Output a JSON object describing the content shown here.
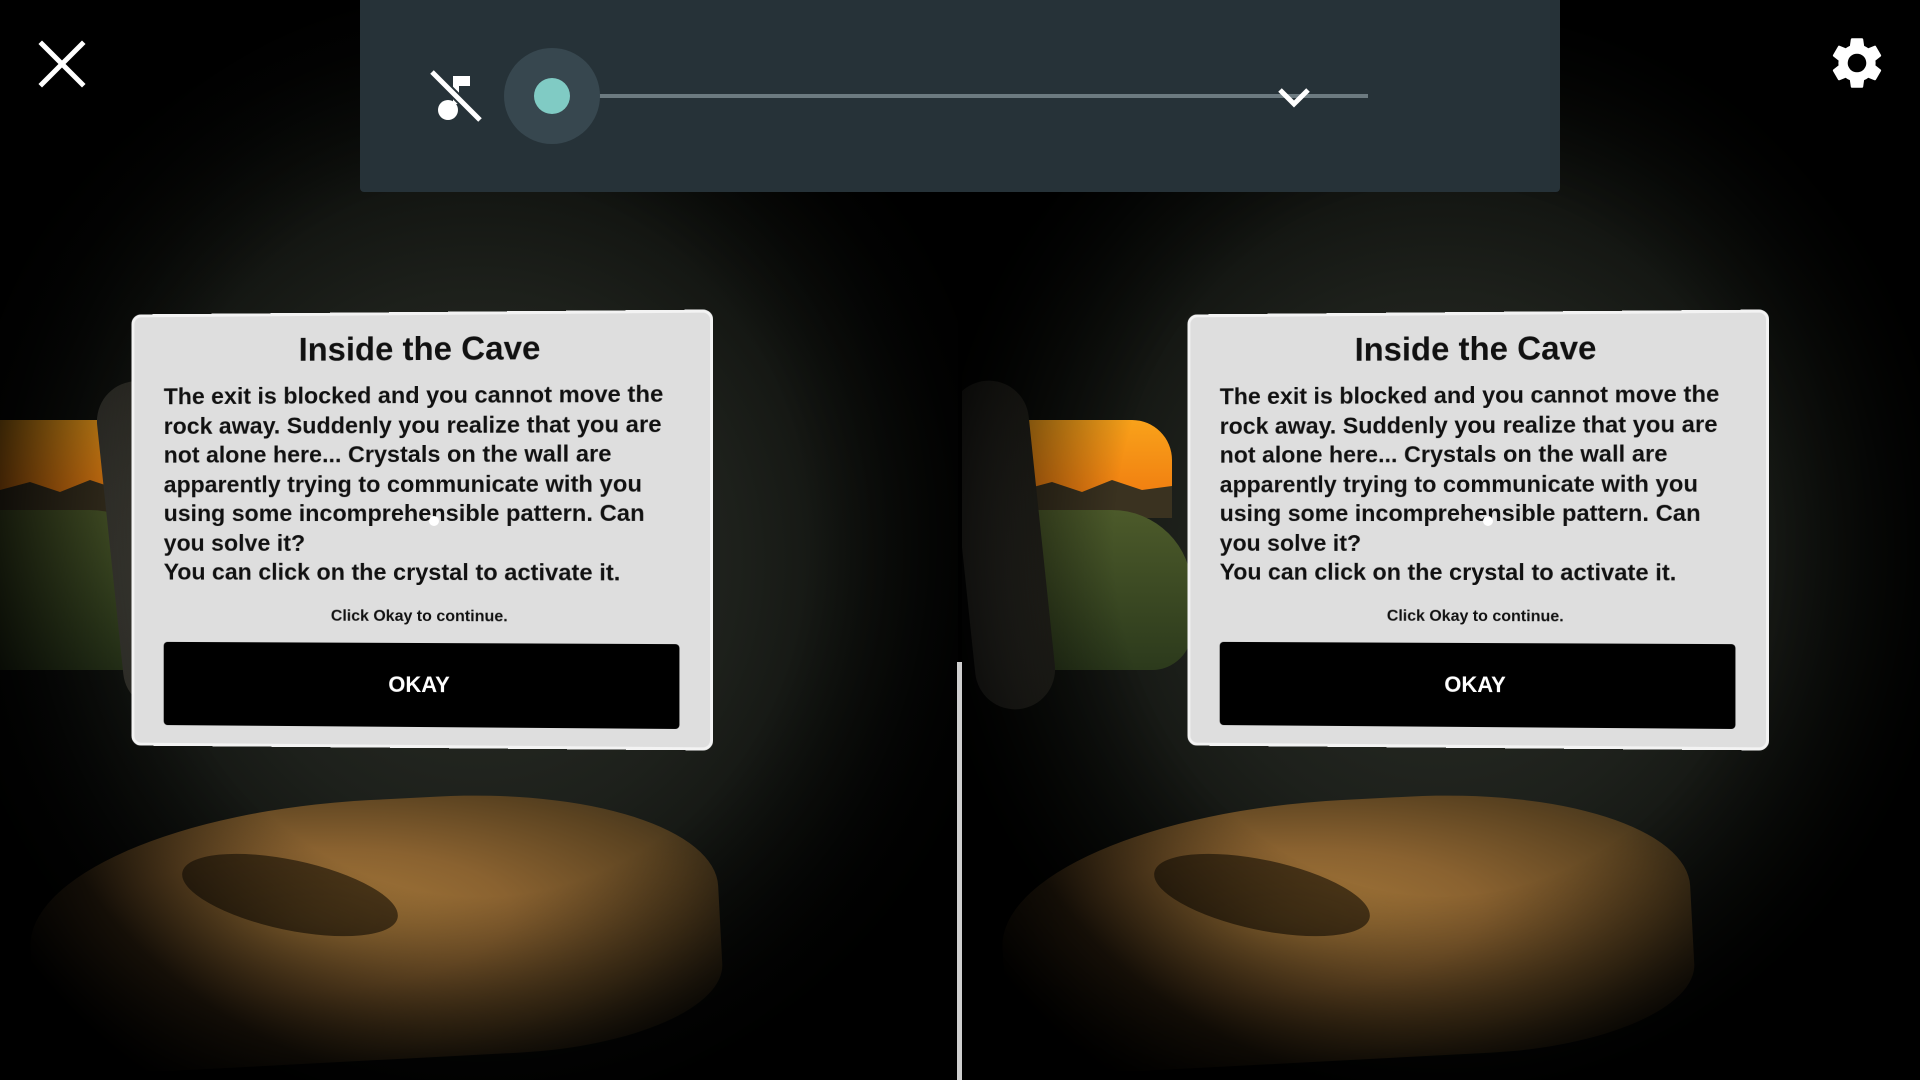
{
  "dialog": {
    "title": "Inside the Cave",
    "body_lines": [
      "The exit is blocked and you cannot move the",
      "rock away. Suddenly you realize that you are",
      "not alone here... Crystals on the wall are",
      "apparently trying to communicate with you",
      "using some incomprehensible pattern. Can",
      "you solve it?",
      "You can click on the crystal to activate it."
    ],
    "hint": "Click Okay to continue.",
    "button_label": "OKAY"
  },
  "media_bar": {
    "progress_fraction": 0.0
  },
  "icons": {
    "close": "close-icon",
    "settings": "gear-icon",
    "music_off": "music-off-icon",
    "collapse": "chevron-down-icon"
  },
  "colors": {
    "media_bar_bg": "#263238",
    "seek_thumb": "#80cbc4",
    "dialog_bg": "#dedede",
    "button_bg": "#000000",
    "sunset": "#f9a21a"
  }
}
